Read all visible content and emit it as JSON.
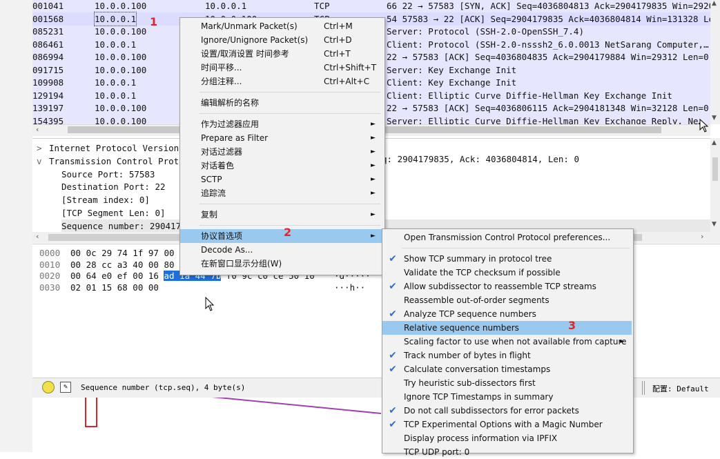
{
  "packet_list": {
    "rows": [
      {
        "no": "001041",
        "src": "10.0.0.100",
        "dst": "10.0.0.1",
        "proto": "TCP",
        "info": "66 22 → 57583 [SYN, ACK] Seq=4036804813 Ack=2904179835 Win=29200…"
      },
      {
        "no": "001568",
        "src": "10.0.0.1",
        "dst": "10.0.0.100",
        "proto": "TCP",
        "info": "54 57583 → 22 [ACK] Seq=2904179835 Ack=4036804814 Win=131328 Len…"
      },
      {
        "no": "085231",
        "src": "10.0.0.100",
        "dst": "",
        "proto": "",
        "info": "Server: Protocol (SSH-2.0-OpenSSH_7.4)"
      },
      {
        "no": "086461",
        "src": "10.0.0.1",
        "dst": "",
        "proto": "",
        "info": "Client: Protocol (SSH-2.0-nsssh2_6.0.0013 NetSarang Computer,…"
      },
      {
        "no": "086994",
        "src": "10.0.0.100",
        "dst": "",
        "proto": "",
        "info": "22 → 57583 [ACK] Seq=4036804835 Ack=2904179884 Win=29312 Len=0"
      },
      {
        "no": "091715",
        "src": "10.0.0.100",
        "dst": "",
        "proto": "",
        "info": "Server: Key Exchange Init"
      },
      {
        "no": "109908",
        "src": "10.0.0.1",
        "dst": "",
        "proto": "",
        "info": "Client: Key Exchange Init"
      },
      {
        "no": "129194",
        "src": "10.0.0.1",
        "dst": "",
        "proto": "",
        "info": "Client: Elliptic Curve Diffie-Hellman Key Exchange Init"
      },
      {
        "no": "139197",
        "src": "10.0.0.100",
        "dst": "",
        "proto": "",
        "info": "22 → 57583 [ACK] Seq=4036806115 Ack=2904181348 Win=32128 Len=0"
      },
      {
        "no": "154395",
        "src": "10.0.0.100",
        "dst": "",
        "proto": "",
        "info": "Server: Elliptic Curve Diffie-Hellman Key Exchange Reply, Ne…"
      }
    ]
  },
  "details": {
    "rows": [
      {
        "twisty": ">",
        "text": "Internet Protocol Version"
      },
      {
        "twisty": "v",
        "text": "Transmission Control Prot"
      },
      {
        "twisty": "",
        "text": "Source Port: 57583"
      },
      {
        "twisty": "",
        "text": "Destination Port: 22"
      },
      {
        "twisty": "",
        "text": "[Stream index: 0]"
      },
      {
        "twisty": "",
        "text": "[TCP Segment Len: 0]"
      },
      {
        "twisty": "",
        "text": "Sequence number: 290417"
      }
    ],
    "tcp_summary_tail": "q: 2904179835, Ack: 4036804814, Len: 0"
  },
  "bytes": {
    "rows": [
      {
        "offset": "0000",
        "hex_pre": "00 0c 29 74 1f 97 00",
        "hex_sel": "",
        "hex_post": "",
        "ascii": ""
      },
      {
        "offset": "0010",
        "hex_pre": "00 28 cc a3 40 00 80",
        "hex_sel": "",
        "hex_post": "",
        "ascii": ""
      },
      {
        "offset": "0020",
        "hex_pre": "00 64 e0 ef 00 16",
        "hex_sel": "ad 1a  44 7b",
        "hex_post": "f0 9c c0 ce 50 10",
        "ascii": "·d·····"
      },
      {
        "offset": "0030",
        "hex_pre": "02 01 15 68 00 00",
        "hex_sel": "",
        "hex_post": "",
        "ascii": "···h··"
      }
    ]
  },
  "statusbar": {
    "field_text": "Sequence number (tcp.seq), 4 byte(s)",
    "profile_text": "配置: Default"
  },
  "context_menu": {
    "items": [
      {
        "label": "Mark/Unmark Packet(s)",
        "shortcut": "Ctrl+M",
        "submenu": false
      },
      {
        "label": "Ignore/Unignore Packet(s)",
        "shortcut": "Ctrl+D",
        "submenu": false
      },
      {
        "label": "设置/取消设置 时间参考",
        "shortcut": "Ctrl+T",
        "submenu": false
      },
      {
        "label": "时间平移...",
        "shortcut": "Ctrl+Shift+T",
        "submenu": false
      },
      {
        "label": "分组注释...",
        "shortcut": "Ctrl+Alt+C",
        "submenu": false
      },
      {
        "separator": true
      },
      {
        "label": "编辑解析的名称",
        "shortcut": "",
        "submenu": false
      },
      {
        "separator": true
      },
      {
        "label": "作为过滤器应用",
        "shortcut": "",
        "submenu": true
      },
      {
        "label": "Prepare as Filter",
        "shortcut": "",
        "submenu": true
      },
      {
        "label": "对话过滤器",
        "shortcut": "",
        "submenu": true
      },
      {
        "label": "对话着色",
        "shortcut": "",
        "submenu": true
      },
      {
        "label": "SCTP",
        "shortcut": "",
        "submenu": true
      },
      {
        "label": "追踪流",
        "shortcut": "",
        "submenu": true
      },
      {
        "separator": true
      },
      {
        "label": "复制",
        "shortcut": "",
        "submenu": true
      },
      {
        "separator": true
      },
      {
        "label": "协议首选项",
        "shortcut": "",
        "submenu": true,
        "highlighted": true
      },
      {
        "label": "Decode As...",
        "shortcut": "",
        "submenu": false
      },
      {
        "label": "在新窗口显示分组(W)",
        "shortcut": "",
        "submenu": false
      }
    ]
  },
  "submenu": {
    "items": [
      {
        "label": "Open Transmission Control Protocol preferences...",
        "checked": false
      },
      {
        "separator": true
      },
      {
        "label": "Show TCP summary in protocol tree",
        "checked": true
      },
      {
        "label": "Validate the TCP checksum if possible",
        "checked": false
      },
      {
        "label": "Allow subdissector to reassemble TCP streams",
        "checked": true
      },
      {
        "label": "Reassemble out-of-order segments",
        "checked": false
      },
      {
        "label": "Analyze TCP sequence numbers",
        "checked": true
      },
      {
        "label": "Relative sequence numbers",
        "checked": false,
        "highlighted": true
      },
      {
        "label": "Scaling factor to use when not available from capture",
        "checked": false,
        "submenu": true
      },
      {
        "label": "Track number of bytes in flight",
        "checked": true
      },
      {
        "label": "Calculate conversation timestamps",
        "checked": true
      },
      {
        "label": "Try heuristic sub-dissectors first",
        "checked": false
      },
      {
        "label": "Ignore TCP Timestamps in summary",
        "checked": false
      },
      {
        "label": "Do not call subdissectors for error packets",
        "checked": true
      },
      {
        "label": "TCP Experimental Options with a Magic Number",
        "checked": true
      },
      {
        "label": "Display process information via IPFIX",
        "checked": false
      },
      {
        "label": "TCP UDP port: 0",
        "checked": false
      }
    ]
  },
  "annotations": {
    "step1": "1",
    "step2": "2",
    "step3": "3"
  },
  "colors": {
    "list_bg": "#e7e6ff",
    "menu_highlight": "#99c9ef",
    "check": "#2d6fd2",
    "annotation": "#e0242e",
    "selection": "#1e6fd9"
  }
}
